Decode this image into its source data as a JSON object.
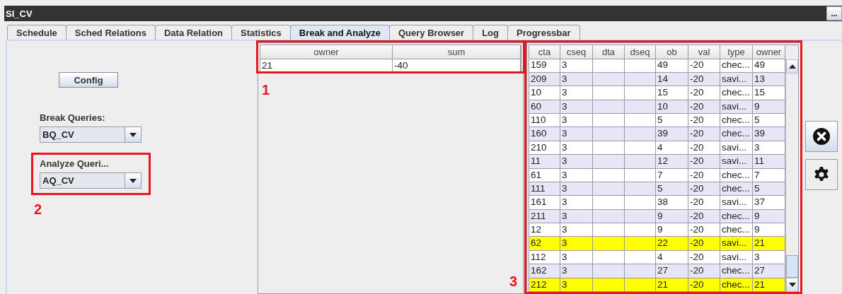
{
  "window": {
    "title": "SI_CV",
    "menu_button": "..."
  },
  "tabs": [
    {
      "label": "Schedule",
      "selected": false
    },
    {
      "label": "Sched Relations",
      "selected": false
    },
    {
      "label": "Data Relation",
      "selected": false
    },
    {
      "label": "Statistics",
      "selected": false
    },
    {
      "label": "Break and Analyze",
      "selected": true
    },
    {
      "label": "Query Browser",
      "selected": false
    },
    {
      "label": "Log",
      "selected": false
    },
    {
      "label": "Progressbar",
      "selected": false
    }
  ],
  "left_panel": {
    "config_button": "Config",
    "break_label": "Break Queries:",
    "break_value": "BQ_CV",
    "analyze_label": "Analyze Queri...",
    "analyze_value": "AQ_CV"
  },
  "summary_table": {
    "columns": [
      "owner",
      "sum"
    ],
    "rows": [
      [
        "21",
        "-40"
      ]
    ]
  },
  "result_table": {
    "columns": [
      "cta",
      "cseq",
      "dta",
      "dseq",
      "ob",
      "val",
      "type",
      "owner"
    ],
    "rows": [
      {
        "cta": "159",
        "cseq": "3",
        "ob": "49",
        "val": "-20",
        "type": "chec...",
        "owner": "49",
        "highlighted": false
      },
      {
        "cta": "209",
        "cseq": "3",
        "ob": "14",
        "val": "-20",
        "type": "savi...",
        "owner": "13",
        "highlighted": false
      },
      {
        "cta": "10",
        "cseq": "3",
        "ob": "15",
        "val": "-20",
        "type": "chec...",
        "owner": "15",
        "highlighted": false
      },
      {
        "cta": "60",
        "cseq": "3",
        "ob": "10",
        "val": "-20",
        "type": "savi...",
        "owner": "9",
        "highlighted": false
      },
      {
        "cta": "110",
        "cseq": "3",
        "ob": "5",
        "val": "-20",
        "type": "chec...",
        "owner": "5",
        "highlighted": false
      },
      {
        "cta": "160",
        "cseq": "3",
        "ob": "39",
        "val": "-20",
        "type": "chec...",
        "owner": "39",
        "highlighted": false
      },
      {
        "cta": "210",
        "cseq": "3",
        "ob": "4",
        "val": "-20",
        "type": "savi...",
        "owner": "3",
        "highlighted": false
      },
      {
        "cta": "11",
        "cseq": "3",
        "ob": "12",
        "val": "-20",
        "type": "savi...",
        "owner": "11",
        "highlighted": false
      },
      {
        "cta": "61",
        "cseq": "3",
        "ob": "7",
        "val": "-20",
        "type": "chec...",
        "owner": "7",
        "highlighted": false
      },
      {
        "cta": "111",
        "cseq": "3",
        "ob": "5",
        "val": "-20",
        "type": "chec...",
        "owner": "5",
        "highlighted": false
      },
      {
        "cta": "161",
        "cseq": "3",
        "ob": "38",
        "val": "-20",
        "type": "savi...",
        "owner": "37",
        "highlighted": false
      },
      {
        "cta": "211",
        "cseq": "3",
        "ob": "9",
        "val": "-20",
        "type": "chec...",
        "owner": "9",
        "highlighted": false
      },
      {
        "cta": "12",
        "cseq": "3",
        "ob": "9",
        "val": "-20",
        "type": "chec...",
        "owner": "9",
        "highlighted": false
      },
      {
        "cta": "62",
        "cseq": "3",
        "ob": "22",
        "val": "-20",
        "type": "savi...",
        "owner": "21",
        "highlighted": true
      },
      {
        "cta": "112",
        "cseq": "3",
        "ob": "4",
        "val": "-20",
        "type": "savi...",
        "owner": "3",
        "highlighted": false
      },
      {
        "cta": "162",
        "cseq": "3",
        "ob": "27",
        "val": "-20",
        "type": "chec...",
        "owner": "27",
        "highlighted": false
      },
      {
        "cta": "212",
        "cseq": "3",
        "ob": "21",
        "val": "-20",
        "type": "chec...",
        "owner": "21",
        "highlighted": true
      }
    ]
  },
  "annotations": [
    {
      "label": "1",
      "kind": "summary"
    },
    {
      "label": "2",
      "kind": "analyze"
    },
    {
      "label": "3",
      "kind": "results"
    }
  ]
}
